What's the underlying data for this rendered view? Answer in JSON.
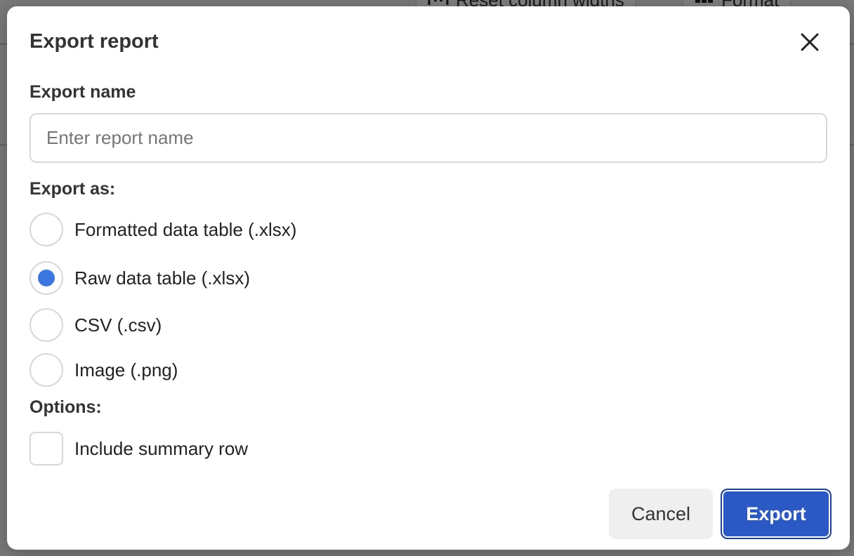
{
  "background": {
    "toolbar_reset_label": "Reset column widths",
    "toolbar_format_label": "Format"
  },
  "dialog": {
    "title": "Export report",
    "name_label": "Export name",
    "name_placeholder": "Enter report name",
    "name_value": "",
    "export_as_label": "Export as:",
    "formats": [
      {
        "label": "Formatted data table (.xlsx)",
        "selected": false
      },
      {
        "label": "Raw data table (.xlsx)",
        "selected": true
      },
      {
        "label": "CSV (.csv)",
        "selected": false
      },
      {
        "label": "Image (.png)",
        "selected": false
      }
    ],
    "options_label": "Options:",
    "options": [
      {
        "label": "Include summary row",
        "checked": false
      }
    ],
    "cancel_label": "Cancel",
    "export_label": "Export"
  },
  "icons": {
    "close": "close-icon",
    "reset_columns": "column-resize-icon",
    "format": "grid-icon"
  },
  "colors": {
    "accent": "#3a77e0",
    "primary_button": "#2a58c4",
    "overlay": "#7f7f7f"
  }
}
